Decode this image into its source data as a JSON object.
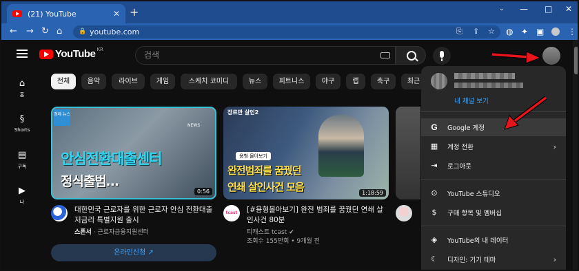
{
  "browser": {
    "tab_title": "(21) YouTube",
    "new_tab": "+",
    "url": "youtube.com"
  },
  "header": {
    "logo": "YouTube",
    "logo_region": "KR",
    "search_placeholder": "검색"
  },
  "guide": [
    {
      "icon": "home-icon",
      "label": "홈"
    },
    {
      "icon": "shorts-icon",
      "label": "Shorts"
    },
    {
      "icon": "subscriptions-icon",
      "label": "구독"
    },
    {
      "icon": "library-icon",
      "label": "나"
    }
  ],
  "chips": [
    "전체",
    "음악",
    "라이브",
    "게임",
    "스케치 코미디",
    "뉴스",
    "피트니스",
    "야구",
    "랩",
    "축구",
    "최근"
  ],
  "videos": [
    {
      "thumb_badge": "경제 뉴스",
      "thumb_tag": "NEWS",
      "thumb_line1": "안심전환대출센터",
      "thumb_line2": "정식출범…",
      "duration": "0:56",
      "title": "대한민국 근로자를 위한 근로자 안심 전환대출 저금리 특별지원 출시",
      "sponsored": "스폰서",
      "channel": "근로자금융지원센터",
      "cta": "온라인신청"
    },
    {
      "thumb_series": "장르만 살인2",
      "thumb_badge": "용형 몰아보기",
      "thumb_line1": "완전범죄를 꿈꿨던",
      "thumb_line2": "연쇄 살인사건 모음",
      "duration": "1:18:59",
      "title": "[#용형몰아보기] 완전 범죄를 꿈꿨던 연쇄 살인사건 80분",
      "channel_icon_text": "tcast",
      "channel": "티캐스트 tcast",
      "stats": "조회수 155만회 • 9개월 전"
    }
  ],
  "account_menu": {
    "channel_link": "내 채널 보기",
    "items": [
      {
        "icon": "google-icon",
        "label": "Google 계정",
        "chevron": false,
        "highlight": true
      },
      {
        "icon": "switch-account-icon",
        "label": "계정 전환",
        "chevron": true
      },
      {
        "icon": "sign-out-icon",
        "label": "로그아웃",
        "chevron": false
      },
      {
        "icon": "youtube-studio-icon",
        "label": "YouTube 스튜디오",
        "chevron": false
      },
      {
        "icon": "purchases-icon",
        "label": "구매 항목 및 멤버십",
        "chevron": false
      },
      {
        "icon": "your-data-icon",
        "label": "YouTube의 내 데이터",
        "chevron": false
      },
      {
        "icon": "appearance-icon",
        "label": "디자인: 기기 테마",
        "chevron": true
      }
    ]
  },
  "colors": {
    "accent_link": "#3ea6ff",
    "brand_red": "#ff0000",
    "annotation_arrow": "#e8141c"
  }
}
